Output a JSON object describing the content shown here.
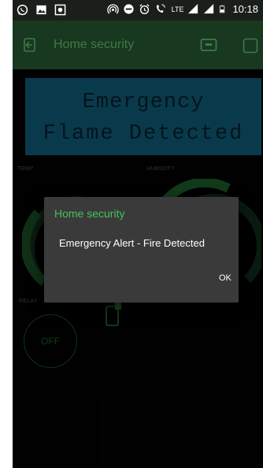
{
  "status_bar": {
    "time": "10:18",
    "network_label": "LTE"
  },
  "app_bar": {
    "title": "Home security"
  },
  "lcd": {
    "line1": "Emergency",
    "line2": "Flame Detected"
  },
  "widgets": {
    "temp_label": "TEMP",
    "humidity_label": "HUMIDITY",
    "relay_label": "RELAY",
    "relay_button": "OFF"
  },
  "dialog": {
    "title": "Home security",
    "message": "Emergency Alert - Fire Detected",
    "ok_label": "OK"
  },
  "colors": {
    "accent": "#43c45a",
    "app_bar": "#18381f",
    "lcd_background": "#0f5a75",
    "dialog_background": "#3a3a3a"
  }
}
